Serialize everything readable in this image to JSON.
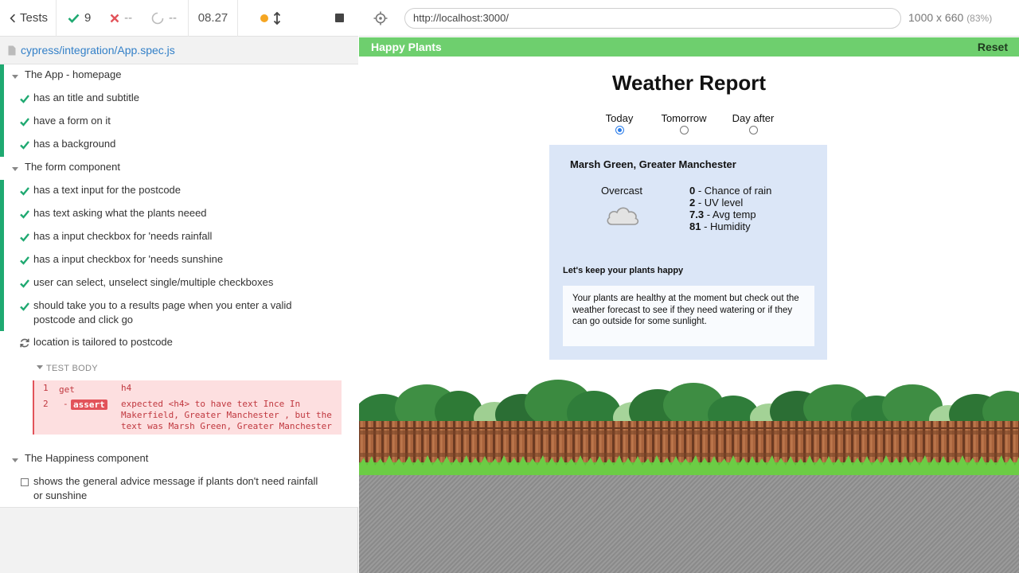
{
  "runner": {
    "tests_label": "Tests",
    "stats": {
      "passed": "9",
      "failed": "--",
      "pending": "--"
    },
    "timer": "08.27",
    "spec_path": "cypress/integration/App.spec.js"
  },
  "reporter": {
    "suites": [
      {
        "title": "The App - homepage",
        "tests": [
          "has an title and subtitle",
          "have a form on it",
          "has a background"
        ]
      },
      {
        "title": "The form component",
        "tests": [
          "has a text input for the postcode",
          "has text asking what the plants neeed",
          "has a input checkbox for 'needs rainfall",
          "has a input checkbox for 'needs sunshine",
          "user can select, unselect single/multiple checkboxes",
          "should take you to a results page when you enter a valid postcode and click go"
        ],
        "running_test": "location is tailored to postcode",
        "test_body_label": "TEST BODY",
        "commands": [
          {
            "num": "1",
            "name": "get",
            "message": "h4"
          },
          {
            "num": "2",
            "name": "assert",
            "prefix": "-",
            "message": "expected <h4> to have text Ince In Makerfield, Greater Manchester , but the text was Marsh Green, Greater Manchester"
          }
        ]
      },
      {
        "title": "The Happiness component",
        "pending_test": "shows the general advice message if plants don't need rainfall or sunshine"
      }
    ]
  },
  "aut": {
    "url": "http://localhost:3000/",
    "viewport": "1000 x 660",
    "scale": "(83%)"
  },
  "app": {
    "brand": "Happy Plants",
    "reset_label": "Reset",
    "title": "Weather Report",
    "day_options": [
      "Today",
      "Tomorrow",
      "Day after"
    ],
    "selected_day": "Today",
    "location": "Marsh Green, Greater Manchester",
    "condition": "Overcast",
    "metrics": [
      {
        "value": "0",
        "label": "Chance of rain"
      },
      {
        "value": "2",
        "label": "UV level"
      },
      {
        "value": "7.3",
        "label": "Avg temp"
      },
      {
        "value": "81",
        "label": "Humidity"
      }
    ],
    "happiness_heading": "Let's keep your plants happy",
    "advice": "Your plants are healthy at the moment but check out the weather forecast to see if they need watering or if they can go outside for some sunlight."
  },
  "colors": {
    "pass": "#1fa971",
    "fail": "#e2535a",
    "navbar": "#6ecf6e",
    "card": "#dbe6f7"
  }
}
